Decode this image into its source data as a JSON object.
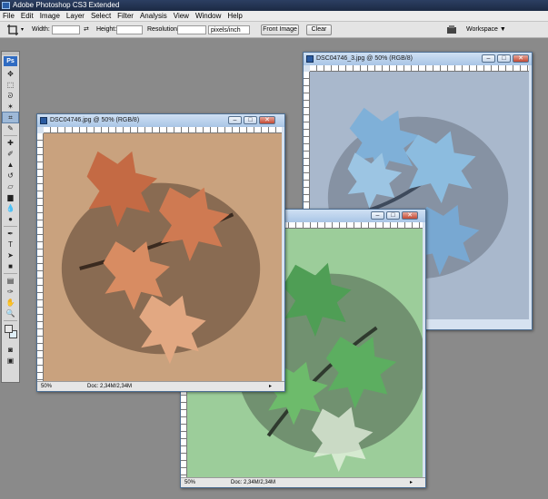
{
  "app": {
    "title": "Adobe Photoshop CS3 Extended"
  },
  "menu": [
    "File",
    "Edit",
    "Image",
    "Layer",
    "Select",
    "Filter",
    "Analysis",
    "View",
    "Window",
    "Help"
  ],
  "options": {
    "width_label": "Width:",
    "height_label": "Height:",
    "resolution_label": "Resolution:",
    "unit": "pixels/inch",
    "front_image": "Front Image",
    "clear": "Clear",
    "workspace": "Workspace ▼"
  },
  "toolbox": {
    "logo": "Ps"
  },
  "windows": [
    {
      "title": "DSC04746_3.jpg @ 50% (RGB/8)",
      "zoom": "",
      "doc": ""
    },
    {
      "title": "DSC04746.jpg @ 50% (RGB/8)",
      "zoom": "50%",
      "doc": "Doc: 2,34M/2,34M"
    },
    {
      "title": "",
      "zoom": "50%",
      "doc": "Doc: 2,34M/2,34M"
    }
  ],
  "colors": {
    "titlebar": "#1c2a44",
    "paper_brown": "#c9a27e",
    "paper_blue": "#a9b8cc",
    "paper_green": "#9ccd9a"
  }
}
